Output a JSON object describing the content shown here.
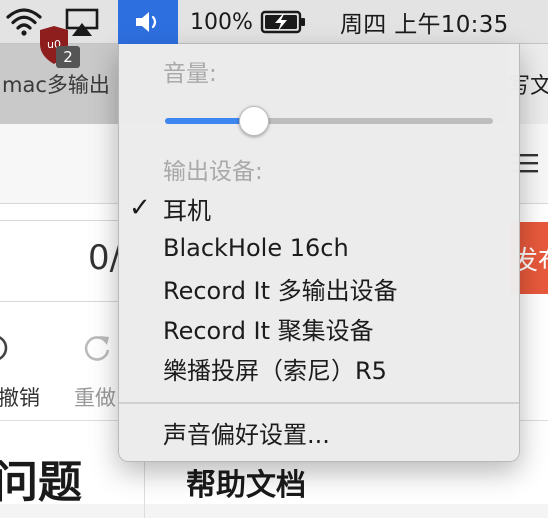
{
  "menubar": {
    "battery_percent": "100%",
    "clock": "周四 上午10:35",
    "icons": [
      "wifi-icon",
      "airplay-icon",
      "volume-icon",
      "battery-charging-icon"
    ]
  },
  "background_app": {
    "tab_left": "mac多输出",
    "tab_right": "写文",
    "extension_badge": "2",
    "counter": "0/",
    "red_button_label": "发布",
    "undo_label": "撤销",
    "redo_label": "重做",
    "big_title": "问题",
    "help_title": "帮助文档"
  },
  "volume_menu": {
    "volume_header": "音量:",
    "volume_level_percent": 27,
    "output_header": "输出设备:",
    "devices": [
      {
        "label": "耳机",
        "selected": true
      },
      {
        "label": "BlackHole 16ch",
        "selected": false
      },
      {
        "label": "Record It 多输出设备",
        "selected": false
      },
      {
        "label": "Record It 聚集设备",
        "selected": false
      },
      {
        "label": "樂播投屏（索尼）R5",
        "selected": false
      }
    ],
    "checkmark": "✓",
    "preferences_label": "声音偏好设置..."
  },
  "colors": {
    "accent_blue": "#3d86f0",
    "menubar_highlight": "#2e6fe0",
    "publish_red": "#e8593c"
  }
}
